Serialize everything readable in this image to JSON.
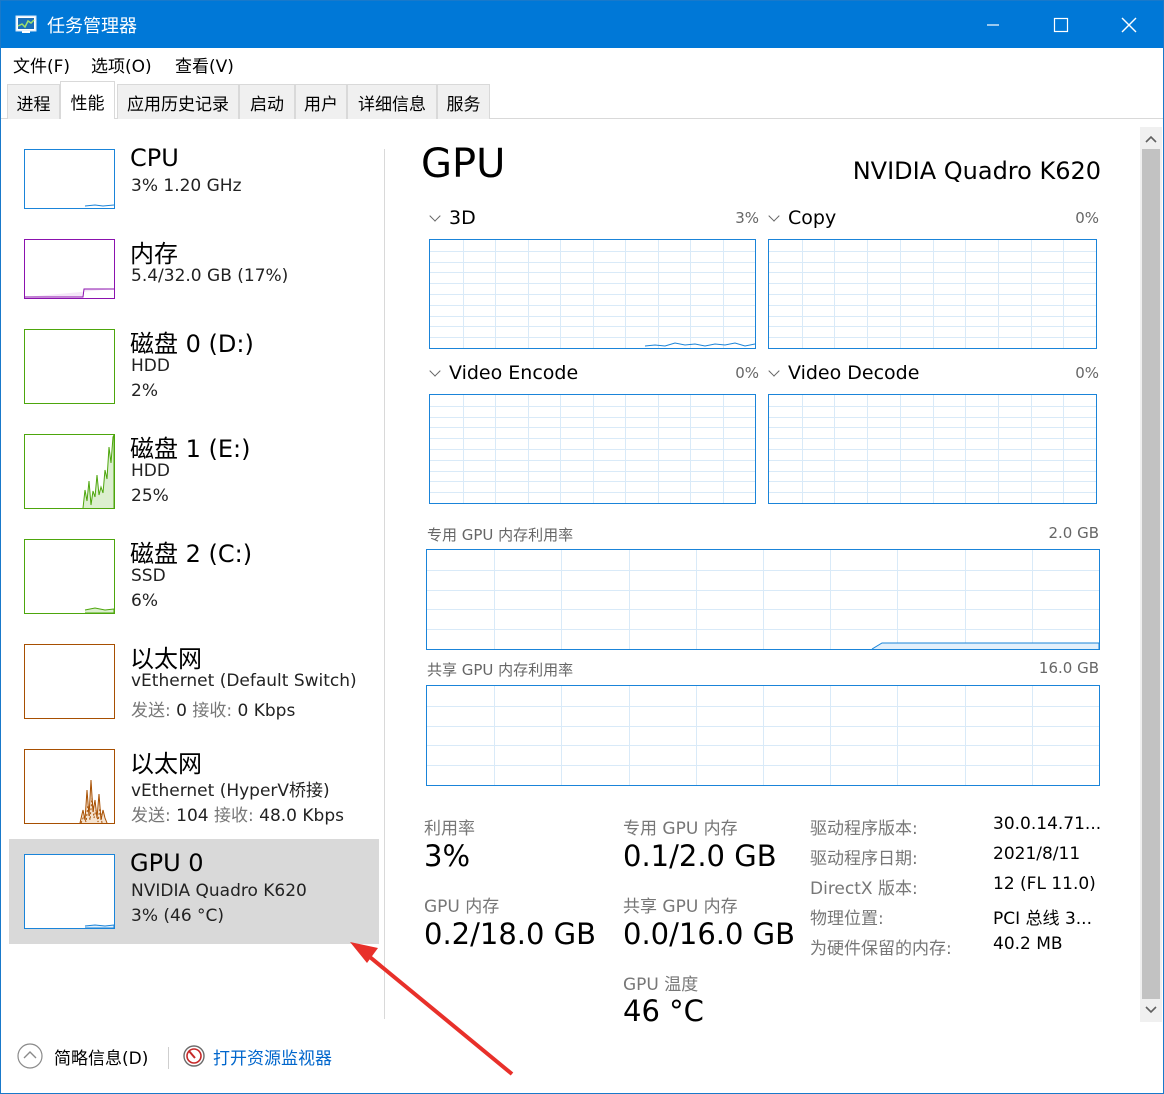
{
  "window": {
    "title": "任务管理器",
    "controls": [
      "minimize",
      "maximize",
      "close"
    ]
  },
  "menu": [
    "文件(F)",
    "选项(O)",
    "查看(V)"
  ],
  "tabs": [
    "进程",
    "性能",
    "应用历史记录",
    "启动",
    "用户",
    "详细信息",
    "服务"
  ],
  "active_tab": "性能",
  "resources": [
    {
      "title": "CPU",
      "sub1": "3% 1.20 GHz",
      "sub2": "",
      "sub3": "",
      "color": "#1a84d9"
    },
    {
      "title": "内存",
      "sub1": "5.4/32.0 GB (17%)",
      "sub2": "",
      "sub3": "",
      "color": "#8b12ae"
    },
    {
      "title": "磁盘 0 (D:)",
      "sub1": "HDD",
      "sub2": "2%",
      "sub3": "",
      "color": "#4da60c"
    },
    {
      "title": "磁盘 1 (E:)",
      "sub1": "HDD",
      "sub2": "25%",
      "sub3": "",
      "color": "#4da60c"
    },
    {
      "title": "磁盘 2 (C:)",
      "sub1": "SSD",
      "sub2": "6%",
      "sub3": "",
      "color": "#4da60c"
    },
    {
      "title": "以太网",
      "sub1": "vEthernet (Default Switch)",
      "send_label": "发送:",
      "send_value": "0",
      "recv_label": "接收:",
      "recv_value": "0 Kbps",
      "color": "#a74f01"
    },
    {
      "title": "以太网",
      "sub1": "vEthernet (HyperV桥接)",
      "send_label": "发送:",
      "send_value": "104",
      "recv_label": "接收:",
      "recv_value": "48.0 Kbps",
      "color": "#a74f01"
    },
    {
      "title": "GPU 0",
      "sub1": "NVIDIA Quadro K620",
      "sub2": "3% (46 °C)",
      "sub3": "",
      "color": "#1a84d9"
    }
  ],
  "selected_resource": "GPU 0",
  "detail": {
    "heading": "GPU",
    "model": "NVIDIA Quadro K620",
    "engines": [
      {
        "name": "3D",
        "percent": "3%"
      },
      {
        "name": "Copy",
        "percent": "0%"
      },
      {
        "name": "Video Encode",
        "percent": "0%"
      },
      {
        "name": "Video Decode",
        "percent": "0%"
      }
    ],
    "dedicated_mem_chart": {
      "label": "专用 GPU 内存利用率",
      "max": "2.0 GB"
    },
    "shared_mem_chart": {
      "label": "共享 GPU 内存利用率",
      "max": "16.0 GB"
    },
    "stats": {
      "utilization_label": "利用率",
      "utilization_value": "3%",
      "dedicated_label": "专用 GPU 内存",
      "dedicated_value": "0.1/2.0 GB",
      "gpu_mem_label": "GPU 内存",
      "gpu_mem_value": "0.2/18.0 GB",
      "shared_label": "共享 GPU 内存",
      "shared_value": "0.0/16.0 GB",
      "temp_label": "GPU 温度",
      "temp_value": "46 °C"
    },
    "properties": [
      {
        "label": "驱动程序版本:",
        "value": "30.0.14.71..."
      },
      {
        "label": "驱动程序日期:",
        "value": "2021/8/11"
      },
      {
        "label": "DirectX 版本:",
        "value": "12 (FL 11.0)"
      },
      {
        "label": "物理位置:",
        "value": "PCI 总线 3..."
      },
      {
        "label": "为硬件保留的内存:",
        "value": "40.2 MB"
      }
    ]
  },
  "footer": {
    "fewer_details": "简略信息(D)",
    "open_monitor": "打开资源监视器"
  },
  "colors": {
    "accent": "#0078d7",
    "gpu_line": "#1a84d9",
    "annotation_arrow": "#e8302a"
  }
}
